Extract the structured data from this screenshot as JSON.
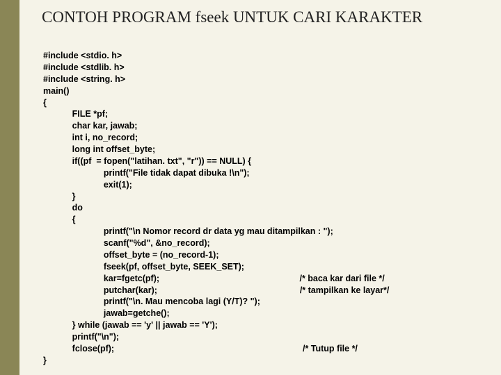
{
  "title": "CONTOH PROGRAM fseek UNTUK CARI KARAKTER",
  "code": {
    "l1": "#include <stdio. h>",
    "l2": "#include <stdlib. h>",
    "l3": "#include <string. h>",
    "l4": "main()",
    "l5": "{",
    "l6": "            FILE *pf;",
    "l7": "            char kar, jawab;",
    "l8": "            int i, no_record;",
    "l9": "            long int offset_byte;",
    "l10": "            if((pf  = fopen(\"latihan. txt\", \"r\")) == NULL) {",
    "l11": "                         printf(\"File tidak dapat dibuka !\\n\");",
    "l12": "                         exit(1);",
    "l13": "            }",
    "l14": "            do",
    "l15": "            {",
    "l16": "                         printf(\"\\n Nomor record dr data yg mau ditampilkan : \");",
    "l17": "                         scanf(\"%d\", &no_record);",
    "l18": "                         offset_byte = (no_record-1);",
    "l19": "                         fseek(pf, offset_byte, SEEK_SET);",
    "l20": "                         kar=fgetc(pf);                                                          /* baca kar dari file */",
    "l21": "                         putchar(kar);                                                           /* tampilkan ke layar*/",
    "l22": "                         printf(\"\\n. Mau mencoba lagi (Y/T)? \");",
    "l23": "                         jawab=getche();",
    "l24": "            } while (jawab == 'y' || jawab == 'Y');",
    "l25": "            printf(\"\\n\");",
    "l26": "            fclose(pf);                                                                              /* Tutup file */",
    "l27": "}"
  }
}
